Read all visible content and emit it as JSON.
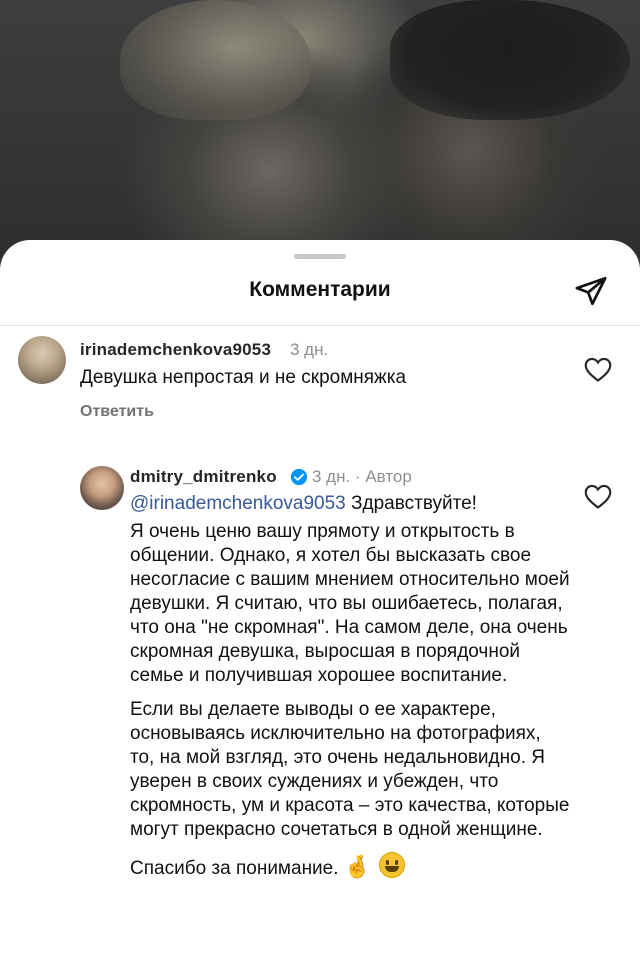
{
  "header": {
    "title": "Комментарии",
    "share_icon": "send-icon"
  },
  "comments": [
    {
      "username": "irinademchenkova9053",
      "time": "3 дн.",
      "text": "Девушка непростая и не скромняжка",
      "reply_label": "Ответить",
      "like_icon": "heart-icon"
    },
    {
      "username": "dmitry_dmitrenko",
      "verified": true,
      "meta": "3 дн. · Автор",
      "mention": "@irinademchenkova9053",
      "greeting": "Здравствуйте!",
      "paragraph1": "Я очень ценю вашу прямоту и открытость в общении. Однако, я хотел бы высказать свое несогласие с вашим мнением относительно моей девушки. Я считаю, что вы ошибаетесь, полагая, что она \"не скромная\". На самом деле, она очень скромная девушка, выросшая в порядочной семье и получившая хорошее воспитание.",
      "paragraph2": "Если вы делаете выводы о ее характере, основываясь исключительно на фотографиях, то, на мой взгляд, это очень недальновидно. Я уверен в своих суждениях и убежден, что скромность, ум и красота – это качества, которые могут прекрасно сочетаться в одной женщине.",
      "closing": "Спасибо за понимание.",
      "closing_emoji": "🤞",
      "like_icon": "heart-icon"
    }
  ],
  "colors": {
    "mention": "#385898",
    "meta": "#8e8e8e",
    "verified": "#0095f6"
  }
}
